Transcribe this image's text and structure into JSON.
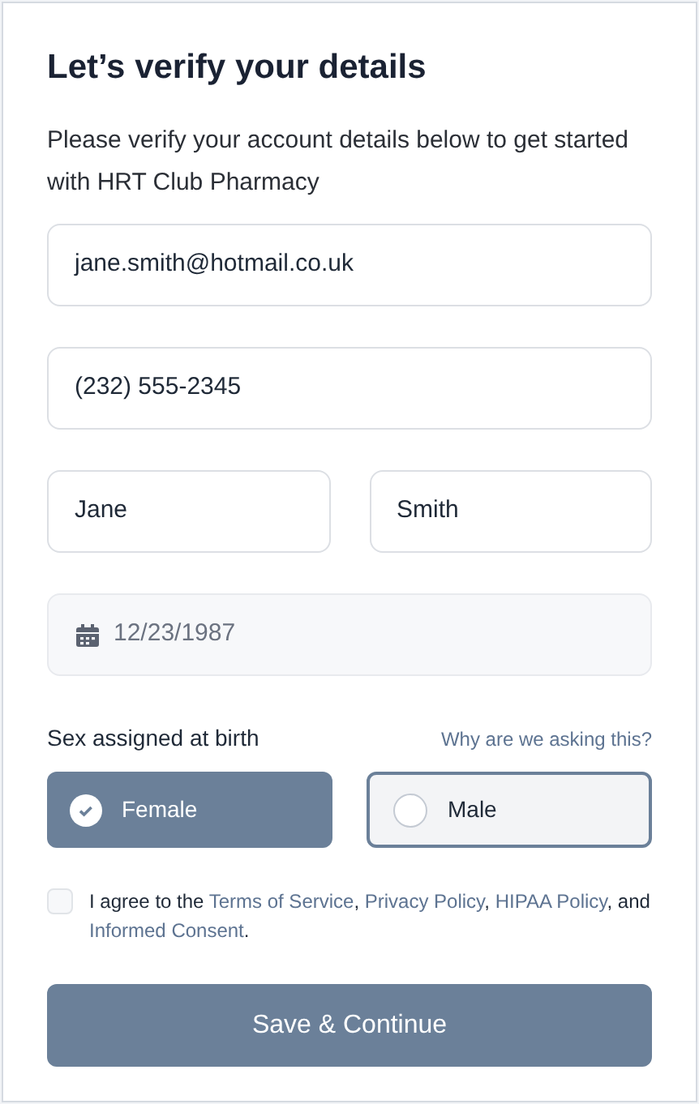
{
  "title": "Let’s verify your details",
  "subtitle": "Please verify your account details below to get started with HRT Club Pharmacy",
  "fields": [
    {
      "value": "jane.smith@hotmail.co.uk",
      "disabled": false
    },
    {
      "value": "(232) 555-2345",
      "disabled": false
    }
  ],
  "name_fields": [
    {
      "value": "Jane"
    },
    {
      "value": "Smith"
    }
  ],
  "date_field": {
    "value": "12/23/1987",
    "disabled": true
  },
  "sex": {
    "label": "Sex assigned at birth",
    "help_link": "Why are we asking this?",
    "options": [
      {
        "label": "Female",
        "selected": true
      },
      {
        "label": "Male",
        "selected": false
      }
    ]
  },
  "consent": {
    "checked": false,
    "segments": [
      {
        "kind": "text",
        "text": "I agree to the "
      },
      {
        "kind": "link",
        "text": "Terms of Service"
      },
      {
        "kind": "text",
        "text": ", "
      },
      {
        "kind": "link",
        "text": "Privacy Policy"
      },
      {
        "kind": "text",
        "text": ", "
      },
      {
        "kind": "link",
        "text": "HIPAA Policy"
      },
      {
        "kind": "text",
        "text": ", and "
      },
      {
        "kind": "link",
        "text": "Informed Consent"
      },
      {
        "kind": "text",
        "text": "."
      }
    ]
  },
  "submit": "Save & Continue"
}
